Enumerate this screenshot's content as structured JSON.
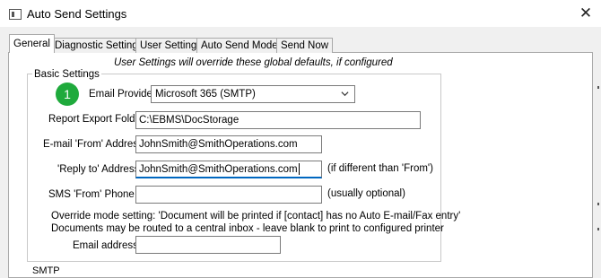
{
  "window": {
    "title": "Auto Send Settings",
    "close_glyph": "✕"
  },
  "tabs": [
    "General",
    "Diagnostic Settings",
    "User Settings",
    "Auto Send Modes",
    "Send Now"
  ],
  "active_tab": "General",
  "note": "User Settings will override these global defaults, if configured",
  "basic": {
    "group_label": "Basic Settings",
    "badge": "1",
    "email_provider_label": "Email Provider:",
    "email_provider_value": "Microsoft 365 (SMTP)",
    "report_folder_label": "Report Export Folder:",
    "report_folder_value": "C:\\EBMS\\DocStorage",
    "from_label": "E-mail 'From' Address:",
    "from_value": "JohnSmith@SmithOperations.com",
    "reply_label": "'Reply to' Address:",
    "reply_value": "JohnSmith@SmithOperations.com",
    "reply_hint": "(if different than 'From')",
    "sms_label": "SMS 'From' Phone #:",
    "sms_value": "",
    "sms_hint": "(usually optional)",
    "override_line1": "Override mode setting: 'Document will be printed if [contact] has no Auto E-mail/Fax entry'",
    "override_line2": "Documents may be routed to a central inbox - leave blank to print to configured printer",
    "email_address_label": "Email address:",
    "email_address_value": ""
  },
  "next_group_label": "SMTP",
  "colors": {
    "badge": "#1faa3c",
    "focus_underline": "#0067c0"
  }
}
